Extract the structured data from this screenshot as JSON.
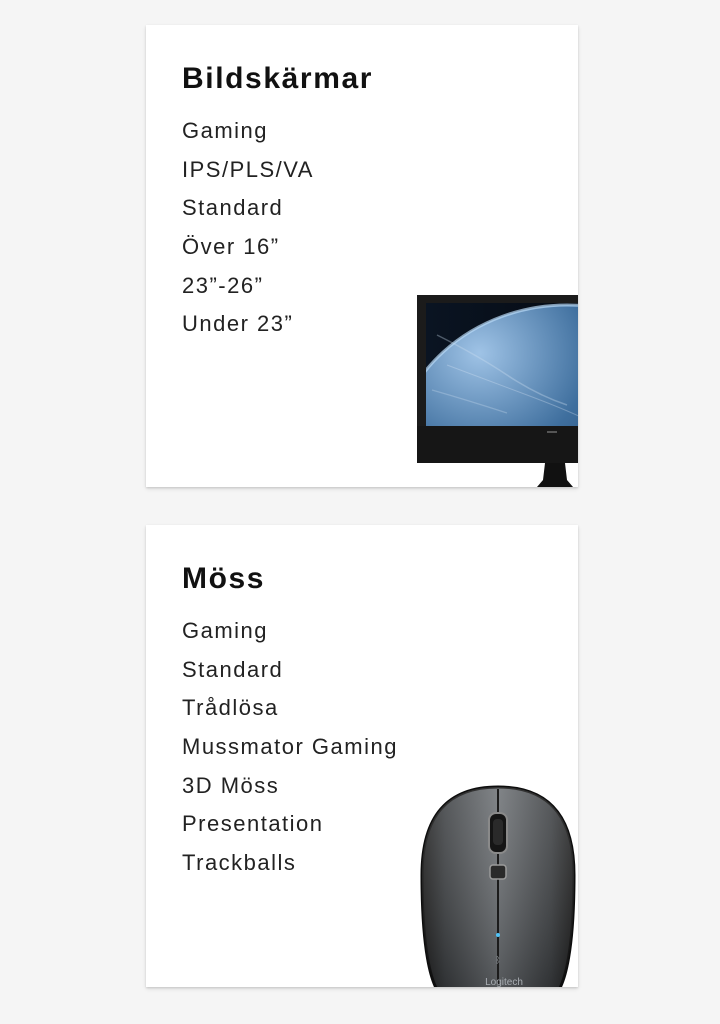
{
  "sections": [
    {
      "title": "Bildskärmar",
      "items": [
        "Gaming",
        "IPS/PLS/VA",
        "Standard",
        "Över 16”",
        "23”-26”",
        "Under 23”"
      ],
      "image": "monitor-image"
    },
    {
      "title": "Möss",
      "items": [
        "Gaming",
        "Standard",
        "Trådlösa",
        "Mussmator Gaming",
        "3D Möss",
        "Presentation",
        "Trackballs"
      ],
      "image": "mouse-image",
      "image_brand_text": "Logitech"
    }
  ]
}
